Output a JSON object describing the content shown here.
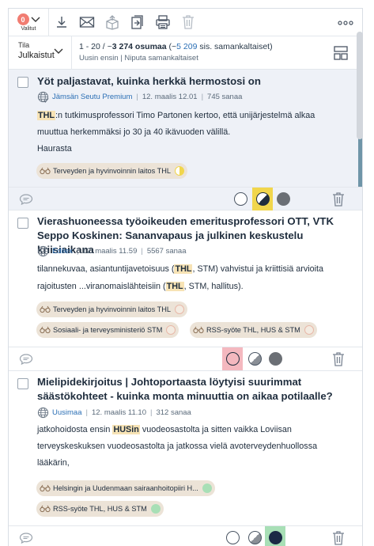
{
  "toolbar": {
    "selected_count": "0",
    "selected_label": "Valitut",
    "icons": [
      "download-icon",
      "email-icon",
      "share-icon",
      "export-icon",
      "copy-icon",
      "trash-icon",
      "more-icon"
    ]
  },
  "filter": {
    "state_label": "Tila",
    "state_value": "Julkaistut"
  },
  "results": {
    "range": "1 - 20 / ~",
    "total": "3 274 osumaa",
    "similar_open": " (~",
    "similar_count": "5 209",
    "similar_rest": " sis. samankaltaiset)",
    "sort": "Uusin ensin",
    "separator": " | ",
    "group": "Niputa samankaltaiset"
  },
  "items": [
    {
      "title": "Yöt paljastavat, kuinka herkkä hermostosi on",
      "source": "Jämsän Seutu Premium",
      "date": "12. maalis 12.01",
      "words": "745 sanaa",
      "excerpt_hl1": "THL",
      "excerpt_p1": ":n tutkimusprofessori Timo Partonen kertoo, että unijärjestelmä alkaa muuttua herkemmäksi jo 30 ja 40 ikävuoden välillä.",
      "excerpt_p2": "Haurasta",
      "tags": [
        {
          "label": "Terveyden ja hyvinvoinnin laitos THL",
          "indicator": "half-yellow"
        }
      ],
      "sentiment": "mixed",
      "sentiment_color": "#f1d64c"
    },
    {
      "title": "Vierashuoneessa työoikeuden emeritusprofessori OTT, VTK Seppo Koskinen: Sananvapaus ja julkinen keskustelu kriisiaikana",
      "source": "Edilex",
      "date": "12. maalis 11.59",
      "words": "5567 sanaa",
      "excerpt_p1": "tilannekuvaa, asiantuntijavetoisuus (",
      "excerpt_hl1": "THL",
      "excerpt_p2": ", STM) vahvistui ja kriittisiä arvioita rajoitusten ...viranomaislähteisiin (",
      "excerpt_hl2": "THL",
      "excerpt_p3": ", STM, hallitus).",
      "tags": [
        {
          "label": "Terveyden ja hyvinvoinnin laitos THL",
          "indicator": "empty"
        },
        {
          "label": "Sosiaali- ja terveysministeriö STM",
          "indicator": "empty"
        },
        {
          "label": "RSS-syöte THL, HUS & STM",
          "indicator": "empty"
        }
      ],
      "sentiment": "negative",
      "sentiment_color": "#f4b8bf"
    },
    {
      "title": "Mielipidekirjoitus | Johtoportaasta löytyisi suurimmat säästökohteet - kuinka monta minuuttia on aikaa potilaalle?",
      "source": "Uusimaa",
      "date": "12. maalis 11.10",
      "words": "312 sanaa",
      "excerpt_p1": "jatkohoidosta ensin ",
      "excerpt_hl1": "HUSin",
      "excerpt_p2": " vuodeosastolta ja sitten vaikka Loviisan terveyskeskuksen vuodeosastolta ja jatkossa vielä avoterveydenhuollossa lääkärin,",
      "tags": [
        {
          "label": "Helsingin ja Uudenmaan sairaanhoitopiiri H...",
          "indicator": "green"
        },
        {
          "label": "RSS-syöte THL, HUS & STM",
          "indicator": "green"
        }
      ],
      "sentiment": "positive",
      "sentiment_color": "#a8dfb6"
    }
  ],
  "colors": {
    "badge": "#f17d72",
    "link": "#2b6fb5",
    "highlight": "#f7e3b5",
    "tag_bg": "#ece3d7",
    "accent_bar": "#6f95a8"
  }
}
